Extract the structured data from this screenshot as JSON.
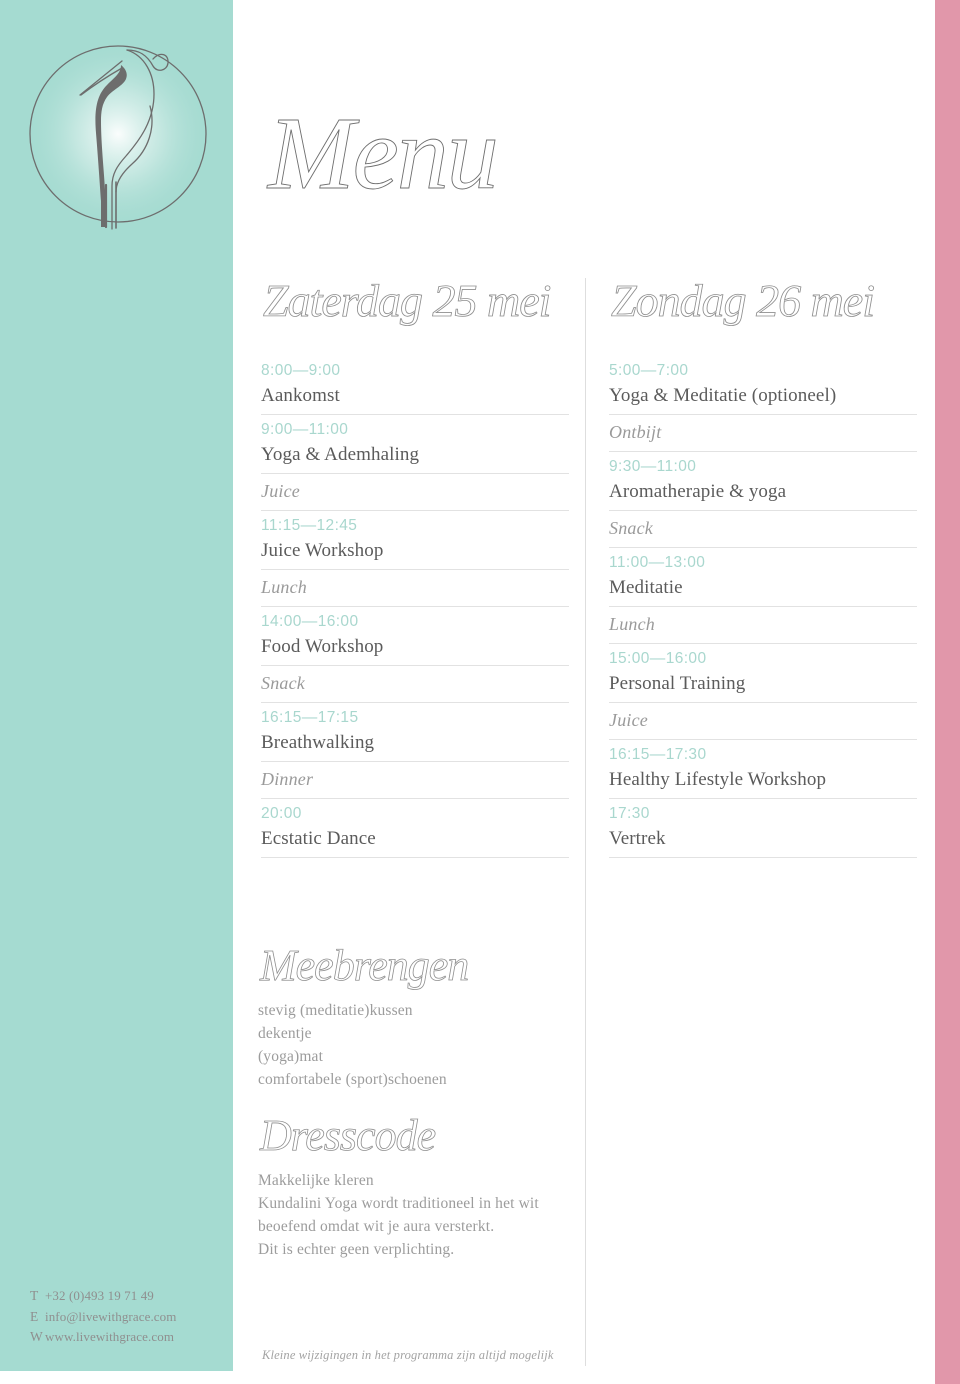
{
  "brand": {
    "logo_icon": "heron-circle-logo",
    "panel_color": "#a5dbd1",
    "accent_pink": "#e197aa",
    "time_color": "#a9d7ce",
    "text_color": "#5b5b5b"
  },
  "header": {
    "title": "Menu"
  },
  "days": [
    {
      "heading": "Zaterdag 25 mei",
      "rows": [
        {
          "kind": "slot",
          "time": "8:00—9:00",
          "activity": "Aankomst"
        },
        {
          "kind": "slot",
          "time": "9:00—11:00",
          "activity": "Yoga & Ademhaling"
        },
        {
          "kind": "meal",
          "label": "Juice"
        },
        {
          "kind": "slot",
          "time": "11:15—12:45",
          "activity": "Juice Workshop"
        },
        {
          "kind": "meal",
          "label": "Lunch"
        },
        {
          "kind": "slot",
          "time": "14:00—16:00",
          "activity": "Food Workshop"
        },
        {
          "kind": "meal",
          "label": "Snack"
        },
        {
          "kind": "slot",
          "time": "16:15—17:15",
          "activity": "Breathwalking"
        },
        {
          "kind": "meal",
          "label": "Dinner"
        },
        {
          "kind": "slot",
          "time": "20:00",
          "activity": "Ecstatic Dance"
        }
      ]
    },
    {
      "heading": "Zondag 26 mei",
      "rows": [
        {
          "kind": "slot",
          "time": "5:00—7:00",
          "activity": "Yoga & Meditatie (optioneel)"
        },
        {
          "kind": "meal",
          "label": "Ontbijt"
        },
        {
          "kind": "slot",
          "time": "9:30—11:00",
          "activity": "Aromatherapie & yoga"
        },
        {
          "kind": "meal",
          "label": "Snack"
        },
        {
          "kind": "slot",
          "time": "11:00—13:00",
          "activity": "Meditatie"
        },
        {
          "kind": "meal",
          "label": "Lunch"
        },
        {
          "kind": "slot",
          "time": "15:00—16:00",
          "activity": "Personal Training"
        },
        {
          "kind": "meal",
          "label": "Juice"
        },
        {
          "kind": "slot",
          "time": "16:15—17:30",
          "activity": "Healthy Lifestyle Workshop"
        },
        {
          "kind": "slot",
          "time": "17:30",
          "activity": "Vertrek"
        }
      ]
    }
  ],
  "bring": {
    "heading": "Meebrengen",
    "items": [
      "stevig (meditatie)kussen",
      "dekentje",
      "(yoga)mat",
      "comfortabele (sport)schoenen"
    ]
  },
  "dresscode": {
    "heading": "Dresscode",
    "lines": [
      "Makkelijke kleren",
      "Kundalini Yoga wordt traditioneel in het wit",
      "beoefend omdat wit je aura versterkt.",
      "Dit is echter geen verplichting."
    ]
  },
  "footer": {
    "contact": [
      {
        "label": "T",
        "value": "+32 (0)493 19 71 49"
      },
      {
        "label": "E",
        "value": "info@livewithgrace.com"
      },
      {
        "label": "W",
        "value": "www.livewithgrace.com"
      }
    ],
    "note": "Kleine wijzigingen in het programma zijn altijd mogelijk"
  }
}
